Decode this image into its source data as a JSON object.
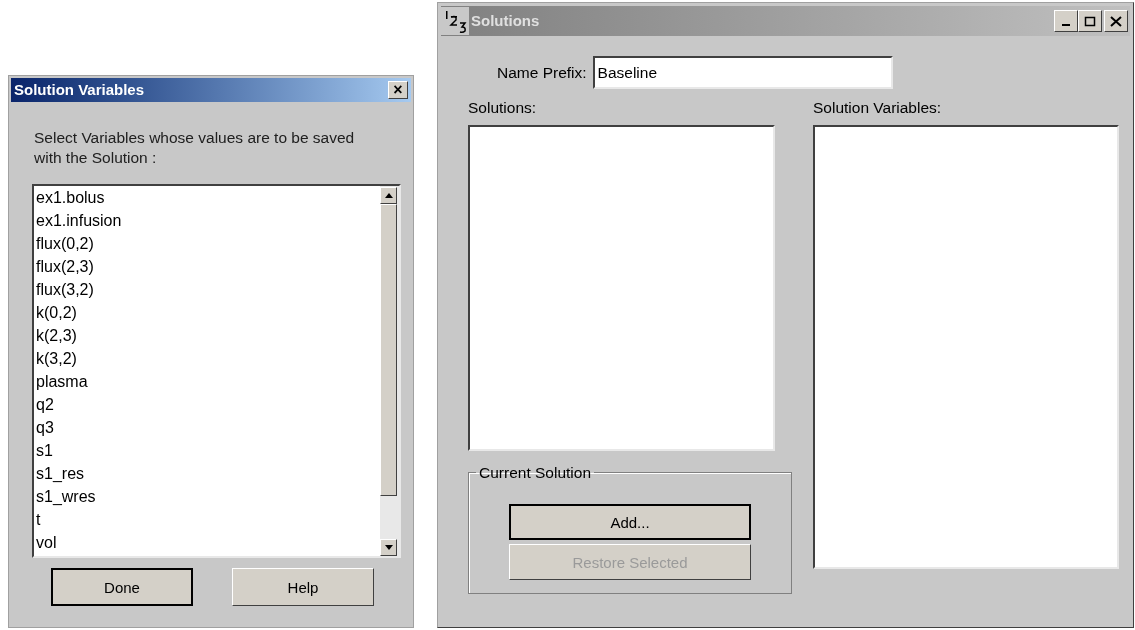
{
  "variables_dialog": {
    "title": "Solution Variables",
    "active": true,
    "close": "×",
    "instruction": "Select Variables whose values are to be saved with the Solution :",
    "variables": [
      {
        "label": "ex1.bolus",
        "selected": false
      },
      {
        "label": "ex1.infusion",
        "selected": false
      },
      {
        "label": "flux(0,2)",
        "selected": false
      },
      {
        "label": "flux(2,3)",
        "selected": false
      },
      {
        "label": "flux(3,2)",
        "selected": false
      },
      {
        "label": "k(0,2)",
        "selected": false
      },
      {
        "label": "k(2,3)",
        "selected": false
      },
      {
        "label": "k(3,2)",
        "selected": false
      },
      {
        "label": "plasma",
        "selected": false
      },
      {
        "label": "q2",
        "selected": false
      },
      {
        "label": "q3",
        "selected": false
      },
      {
        "label": "s1",
        "selected": false
      },
      {
        "label": "s1_res",
        "selected": false
      },
      {
        "label": "s1_wres",
        "selected": false
      },
      {
        "label": "t",
        "selected": false
      },
      {
        "label": "vol",
        "selected": false
      }
    ],
    "buttons": [
      {
        "label": "Done",
        "default": true,
        "disabled": false
      },
      {
        "label": "Help",
        "default": false,
        "disabled": false
      }
    ]
  },
  "solutions_window": {
    "title": "Solutions",
    "active": false,
    "name_prefix_label": "Name Prefix:",
    "name_prefix_value": "Baseline",
    "solutions_label": "Solutions:",
    "solution_variables_label": "Solution Variables:",
    "group_title": "Current Solution",
    "buttons": [
      {
        "label": "Add...",
        "default": true,
        "disabled": false
      },
      {
        "label": "Restore Selected",
        "default": false,
        "disabled": true
      }
    ]
  }
}
